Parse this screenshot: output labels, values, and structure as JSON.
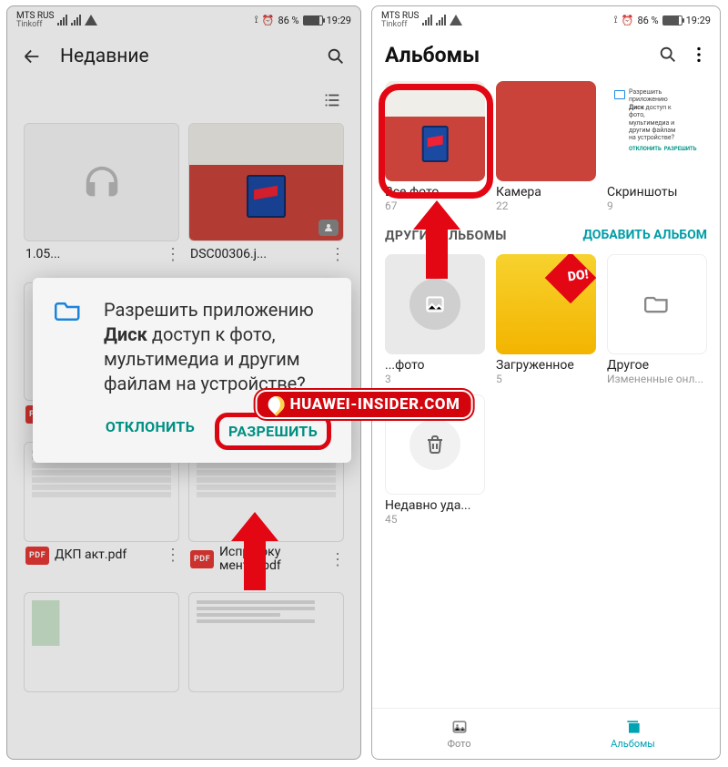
{
  "left": {
    "status": {
      "carrier": "MTS RUS",
      "sub": "Tinkoff",
      "battery": "86 %",
      "time": "19:29"
    },
    "appbar_title": "Недавние",
    "files": {
      "r1a": "1.05...",
      "r1b": "DSC00306.j...",
      "dkp": "ДКП акт.pdf",
      "ispr": "Испр доку менты.pdf",
      "pdf_badge": "PDF"
    },
    "dialog": {
      "text_pre": "Разрешить приложению ",
      "app": "Диск",
      "text_post": " доступ к фото, мультимедиа и другим файлам на устройстве?",
      "deny": "ОТКЛОНИТЬ",
      "allow": "РАЗРЕШИТЬ"
    }
  },
  "right": {
    "status": {
      "carrier": "MTS RUS",
      "sub": "Tinkoff",
      "battery": "86 %",
      "time": "19:29"
    },
    "title": "Альбомы",
    "albums_top": [
      {
        "name": "Все фото",
        "count": "67"
      },
      {
        "name": "Камера",
        "count": "22"
      },
      {
        "name": "Скриншоты",
        "count": "9"
      }
    ],
    "section": "ДРУГИЕ АЛЬБОМЫ",
    "add": "ДОБАВИТЬ АЛЬБОМ",
    "albums_other": [
      {
        "name": "...фото",
        "count": "3"
      },
      {
        "name": "Загруженное",
        "count": "5"
      },
      {
        "name": "Другое",
        "count": "Измененные онл..."
      },
      {
        "name": "Недавно уда...",
        "count": "45"
      }
    ],
    "bnav": {
      "photos": "Фото",
      "albums": "Альбомы"
    }
  },
  "watermark": "HUAWEI-INSIDER.COM",
  "mini": {
    "deny": "ОТКЛОНИТЬ",
    "allow": "РАЗРЕШИТЬ"
  }
}
